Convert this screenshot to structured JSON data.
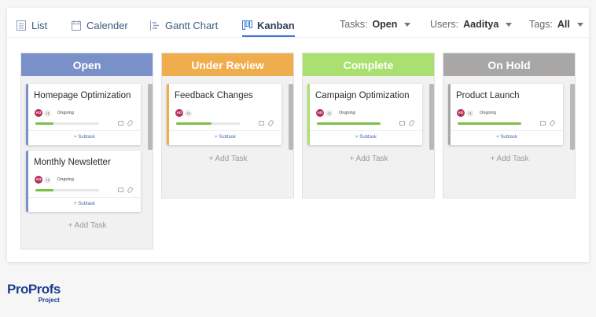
{
  "views": [
    {
      "label": "List",
      "icon": "list-icon"
    },
    {
      "label": "Calender",
      "icon": "calendar-icon"
    },
    {
      "label": "Gantt Chart",
      "icon": "gantt-icon"
    },
    {
      "label": "Kanban",
      "icon": "kanban-icon"
    }
  ],
  "active_view": "Kanban",
  "filters": {
    "tasks": {
      "label": "Tasks:",
      "value": "Open"
    },
    "users": {
      "label": "Users:",
      "value": "Aaditya"
    },
    "tags": {
      "label": "Tags:",
      "value": "All"
    }
  },
  "columns": [
    {
      "title": "Open",
      "color": "#7a90c8",
      "accent": "#7a90c8",
      "cards": [
        {
          "title": "Homepage Optimization",
          "avatar": "AO",
          "plus": "+1",
          "status": "Ongoing",
          "progress": 0.28,
          "subtask": "+ Subtask"
        },
        {
          "title": "Monthly Newsletter",
          "avatar": "AO",
          "plus": "+1",
          "status": "Ongoing",
          "progress": 0.28,
          "subtask": "+ Subtask"
        }
      ],
      "add_task": "+ Add Task"
    },
    {
      "title": "Under Review",
      "color": "#f0ad4e",
      "accent": "#f0ad4e",
      "cards": [
        {
          "title": "Feedback Changes",
          "avatar": "AO",
          "plus": "+1",
          "status": "",
          "progress": 0.55,
          "subtask": "+ Subtask"
        }
      ],
      "add_task": "+ Add Task"
    },
    {
      "title": "Complete",
      "color": "#a9e070",
      "accent": "#a9e070",
      "cards": [
        {
          "title": "Campaign Optimization",
          "avatar": "AO",
          "plus": "+1",
          "status": "Ongoing",
          "progress": 1.0,
          "subtask": "+ Subtask"
        }
      ],
      "add_task": "+ Add Task"
    },
    {
      "title": "On Hold",
      "color": "#a8a7a6",
      "accent": "#a8a7a6",
      "cards": [
        {
          "title": "Product Launch",
          "avatar": "AO",
          "plus": "+1",
          "status": "Ongoing",
          "progress": 1.0,
          "subtask": "+ Subtask"
        }
      ],
      "add_task": "+ Add Task"
    }
  ],
  "logo": {
    "brand_part1": "Pro",
    "brand_part2": "Profs",
    "sub": "Project"
  }
}
